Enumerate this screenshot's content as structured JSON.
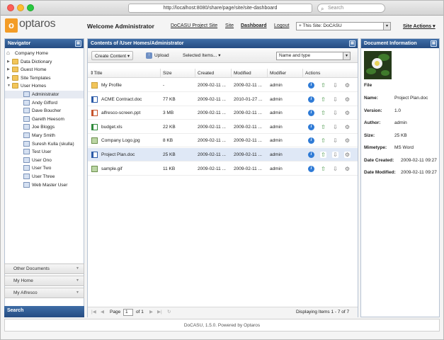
{
  "browser": {
    "url": "http://localhost:8080/share/page/site/site-dashboard",
    "search_placeholder": "Search"
  },
  "header": {
    "logo_text": "optaros",
    "logo_mark": "o",
    "welcome": "Welcome Administrator",
    "links": [
      "DoCASU Project Site",
      "Site",
      "Dashboard",
      "Logout"
    ],
    "site_select_value": "+ This Site: DoCASU",
    "site_actions": "Site Actions ▾"
  },
  "navigator": {
    "title": "Navigator",
    "tree": [
      {
        "label": "Company Home",
        "type": "root"
      },
      {
        "label": "Data Dictionary",
        "type": "folder"
      },
      {
        "label": "Guest Home",
        "type": "folder"
      },
      {
        "label": "Site Templates",
        "type": "folder"
      },
      {
        "label": "User Homes",
        "type": "folder-open"
      },
      {
        "label": "Administrator",
        "type": "user",
        "selected": true
      },
      {
        "label": "Andy Gifford",
        "type": "user"
      },
      {
        "label": "Dave Boucher",
        "type": "user"
      },
      {
        "label": "Gareth Heesom",
        "type": "user"
      },
      {
        "label": "Joe Bloggs",
        "type": "user"
      },
      {
        "label": "Mary Smith",
        "type": "user"
      },
      {
        "label": "Suresh Kulla (skulla)",
        "type": "user"
      },
      {
        "label": "Test User",
        "type": "user"
      },
      {
        "label": "User Ono",
        "type": "user"
      },
      {
        "label": "User Two",
        "type": "user"
      },
      {
        "label": "User Three",
        "type": "user"
      },
      {
        "label": "Web Master User",
        "type": "user"
      }
    ],
    "accordion": [
      "Other Documents",
      "My Home",
      "My Alfresco"
    ],
    "search_title": "Search"
  },
  "contents": {
    "title": "Contents of /User Homes/Administrator",
    "toolbar": {
      "create": "Create Content ▾",
      "upload": "Upload",
      "selected": "Selected Items... ▾",
      "sort_value": "Name and type"
    },
    "columns": [
      "Title",
      "Size",
      "Created",
      "Modified",
      "Modifier",
      "Actions"
    ],
    "rows": [
      {
        "title": "My Profile",
        "size": "-",
        "created": "2009-02-11 ...",
        "modified": "2009-02-11 ...",
        "modifier": "admin",
        "icon": "folder"
      },
      {
        "title": "ACME Contract.doc",
        "size": "77 KB",
        "created": "2009-02-11 ...",
        "modified": "2010-01-27 ...",
        "modifier": "admin",
        "icon": "doc"
      },
      {
        "title": "alfresco-screen.ppt",
        "size": "3 MB",
        "created": "2009-02-11 ...",
        "modified": "2009-02-11 ...",
        "modifier": "admin",
        "icon": "ppt"
      },
      {
        "title": "budget.xls",
        "size": "22 KB",
        "created": "2009-02-11 ...",
        "modified": "2009-02-11 ...",
        "modifier": "admin",
        "icon": "xls"
      },
      {
        "title": "Company Logo.jpg",
        "size": "8 KB",
        "created": "2009-02-11 ...",
        "modified": "2009-02-11 ...",
        "modifier": "admin",
        "icon": "img"
      },
      {
        "title": "Project Plan.doc",
        "size": "25 KB",
        "created": "2009-02-11 ...",
        "modified": "2009-02-11 ...",
        "modifier": "admin",
        "icon": "doc",
        "selected": true
      },
      {
        "title": "sample.gif",
        "size": "11 KB",
        "created": "2009-02-11 ...",
        "modified": "2009-02-11 ...",
        "modifier": "admin",
        "icon": "img"
      }
    ],
    "pager": {
      "page_label": "Page",
      "page_value": "1",
      "of_label": "of 1",
      "display_text": "Displaying Items 1 - 7 of 7"
    }
  },
  "document_info": {
    "title": "Document Information",
    "file_label": "File",
    "fields": [
      {
        "label": "Name:",
        "value": "Project Plan.doc"
      },
      {
        "label": "Version:",
        "value": "1.0"
      },
      {
        "label": "Author:",
        "value": "admin"
      },
      {
        "label": "Size:",
        "value": "25 KB"
      },
      {
        "label": "Mimetype:",
        "value": "MS Word"
      },
      {
        "label": "Date Created:",
        "value": "2009-02-11 09:27"
      },
      {
        "label": "Date Modified:",
        "value": "2009-02-11 09:27"
      }
    ]
  },
  "footer": {
    "text": "DoCASU, 1.5.0. Powered by Optaros"
  },
  "colors": {
    "panel_header": "#2e5a93",
    "logo_orange": "#f39c27",
    "selected_row": "#dfe8f6"
  }
}
